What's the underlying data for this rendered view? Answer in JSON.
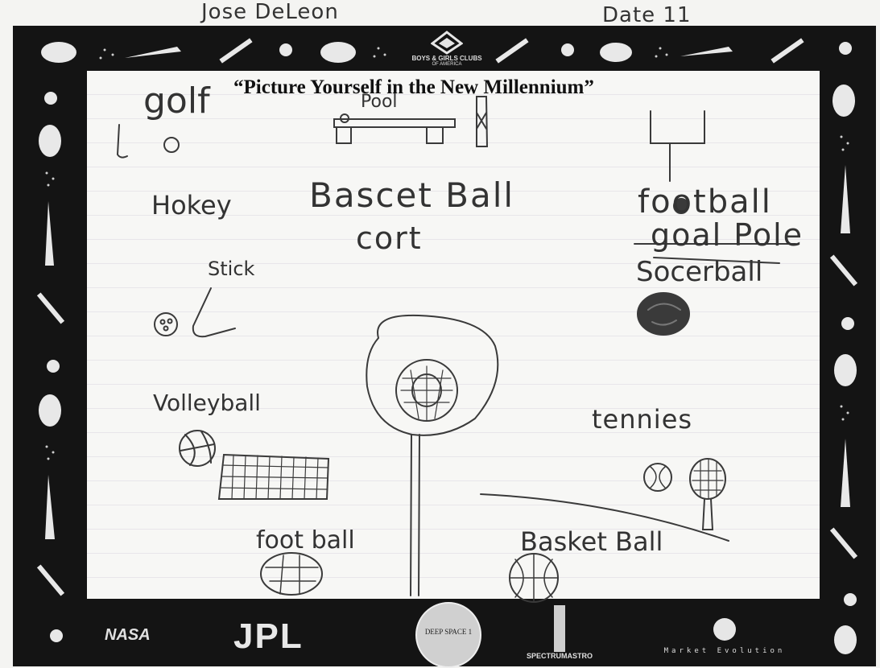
{
  "header": {
    "student_name": "Jose DeLeon",
    "date_label": "Date 11"
  },
  "frame": {
    "sponsor_logo": "BOYS & GIRLS CLUBS",
    "sponsor_logo_sub": "OF AMERICA",
    "title": "“Picture Yourself in the New Millennium”",
    "footer_logos": [
      "NASA",
      "JPL",
      "DEEP SPACE 1",
      "SPECTRUMASTRO",
      "Market Evolution"
    ]
  },
  "drawing": {
    "labels": {
      "golf": "golf",
      "pool": "Pool",
      "basketball_court_1": "Bascet Ball",
      "basketball_court_2": "cort",
      "hockey": "Hokey",
      "stick": "Stick",
      "football_top": "football",
      "goal_pole": "goal Pole",
      "soccerball": "Socerball",
      "volleyball": "Volleyball",
      "tennis": "tennies",
      "football_bottom": "foot ball",
      "basketball_bottom": "Basket Ball"
    }
  },
  "colors": {
    "frame": "#141414",
    "paper": "#f7f7f5",
    "ink": "#333333"
  }
}
